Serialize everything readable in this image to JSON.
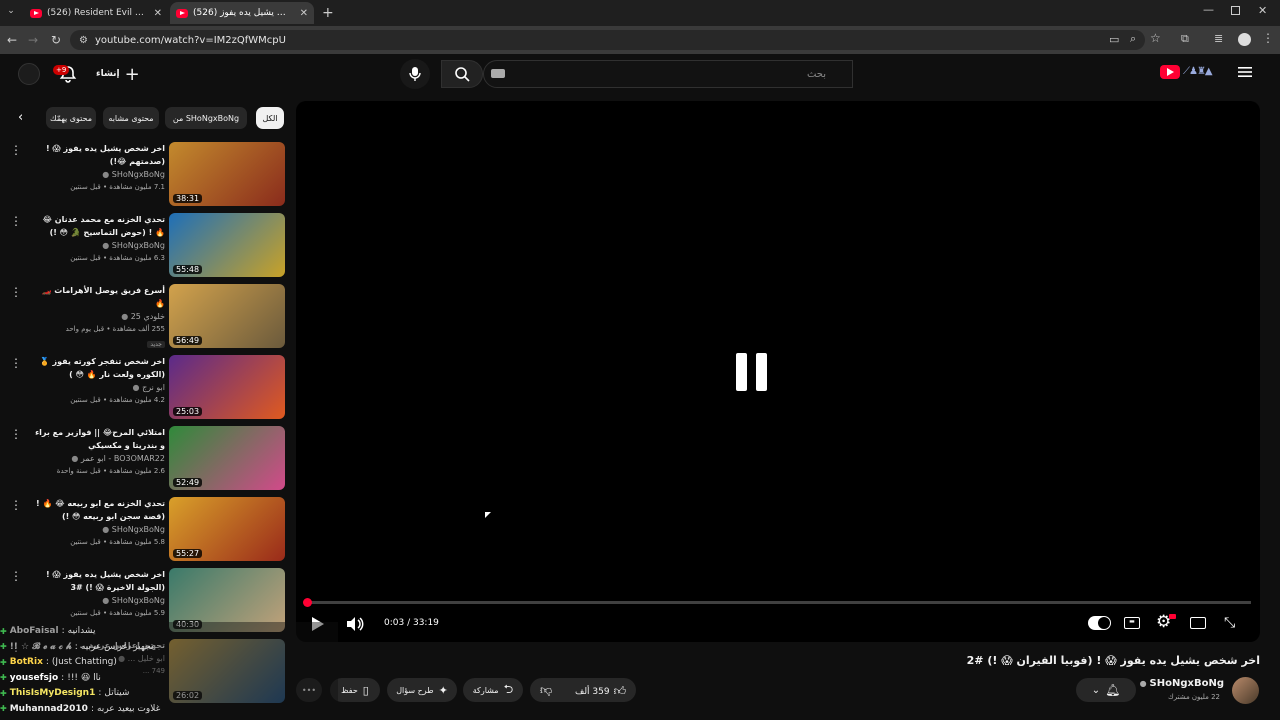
{
  "browser": {
    "tabs": [
      {
        "label": "(526) Resident Evil 9 Requiem 🕹️"
      },
      {
        "label": "(526) اخر شخص يشيل يده يفوز"
      }
    ],
    "url": "youtube.com/watch?v=IM2zQfWMcpU"
  },
  "header": {
    "create_label": "إنشاء",
    "notif_badge": "+9",
    "search_placeholder": "بحث"
  },
  "chips": [
    {
      "label": "الكل",
      "selected": true
    },
    {
      "label": "من SHoNgxBoNg",
      "selected": false
    },
    {
      "label": "محتوى مشابه",
      "selected": false
    },
    {
      "label": "محتوى يهمّك",
      "selected": false
    }
  ],
  "videos": [
    {
      "title": "اخر شخص يشيل يده يفوز 😱 ! (صدمتهم 😂!)",
      "channel": "SHoNgxBoNg",
      "views": "7.1 مليون مشاهدة • قبل سنتين",
      "duration": "38:31",
      "colors": [
        "#c38a2d",
        "#8a2b1c"
      ]
    },
    {
      "title": "تحدي الخزنه مع محمد عدنان 😂 🔥 ! (حوض التماسيح 🐊 😳 !)",
      "channel": "SHoNgxBoNg",
      "views": "6.3 مليون مشاهدة • قبل سنتين",
      "duration": "55:48",
      "colors": [
        "#1e6fb8",
        "#c9a227"
      ]
    },
    {
      "title": "أسرع فريق يوصل الأهرامات 🏎️ 🔥",
      "channel": "خلودي 25",
      "views": "255 ألف مشاهدة • قبل يوم واحد",
      "badge": "جديد",
      "duration": "56:49",
      "colors": [
        "#d2a24c",
        "#6b5a3c"
      ]
    },
    {
      "title": "اخر شخص تنفجر كورته يفوز 🏅 (الكوره ولعت نار 🔥 😳 )",
      "channel": "ابو نرج",
      "views": "4.2 مليون مشاهدة • قبل سنتين",
      "duration": "25:03",
      "colors": [
        "#5b2a8a",
        "#e05a1f"
      ]
    },
    {
      "title": "امتلائي المرح😂 || فوازير مع براء و بندريتا و مكسيكي",
      "channel": "BO3OMAR22 - ابو عمر",
      "views": "2.6 مليون مشاهدة • قبل سنة واحدة",
      "duration": "52:49",
      "colors": [
        "#2f8a3a",
        "#d24a8a"
      ]
    },
    {
      "title": "تحدي الخزنه مع ابو ربيعه 😂 🔥 ! (قصة سجن ابو ربيعه 😳 !)",
      "channel": "SHoNgxBoNg",
      "views": "5.8 مليون مشاهدة • قبل سنتين",
      "duration": "55:27",
      "colors": [
        "#d9a02a",
        "#9a2a1a"
      ]
    },
    {
      "title": "اخر شخص يشيل يده يفوز 😱 ! (الجولة الاخيرة 😱 !) #3",
      "channel": "SHoNgxBoNg",
      "views": "5.9 مليون مشاهدة • قبل سنتين",
      "duration": "40:30",
      "colors": [
        "#3a7a6a",
        "#c2a27a"
      ]
    },
    {
      "title": "تجهيز اعراس عربية...",
      "channel": "ابو خليل ...",
      "views": "749 ...",
      "duration": "26:02",
      "colors": [
        "#c7a24a",
        "#2a5a8a"
      ]
    }
  ],
  "player": {
    "time": "0:03 / 33:19",
    "progress": 0.0015
  },
  "video": {
    "title": "اخر شخص يشيل يده يفوز 😱 ! (فوبيا الفيران 😱 !) #2",
    "channel": "SHoNgxBoNg",
    "subs": "22 مليون مشترك",
    "likes": "359 ألف",
    "share": "مشاركة",
    "ask": "طرح سؤال",
    "save": "حفظ"
  },
  "chat": [
    {
      "user": "AboFaisal",
      "msg": "يشدانيه",
      "color": "#9e9e9e"
    },
    {
      "user": "!! ☆ 𝓑 𝓮 𝓪 𝓬 𝓱",
      "msg": "تجهيز اعراس عربيه",
      "color": "#9e9e9e"
    },
    {
      "user": "BotRix",
      "msg": "(Just Chatting)",
      "color": "#ffd54a"
    },
    {
      "user": "yousefsjo",
      "msg": "!!! 😆 ناا",
      "color": "#ffffff"
    },
    {
      "user": "ThisIsMyDesign1",
      "msg": "شيتاتل",
      "color": "#f5e663"
    },
    {
      "user": "Muhannad2010",
      "msg": "غلاوت بيعيد عربه",
      "color": "#f1f1f1"
    }
  ],
  "colors": {
    "accent": "#ff0033",
    "bg": "#0f0f0f",
    "chip": "#272727"
  }
}
